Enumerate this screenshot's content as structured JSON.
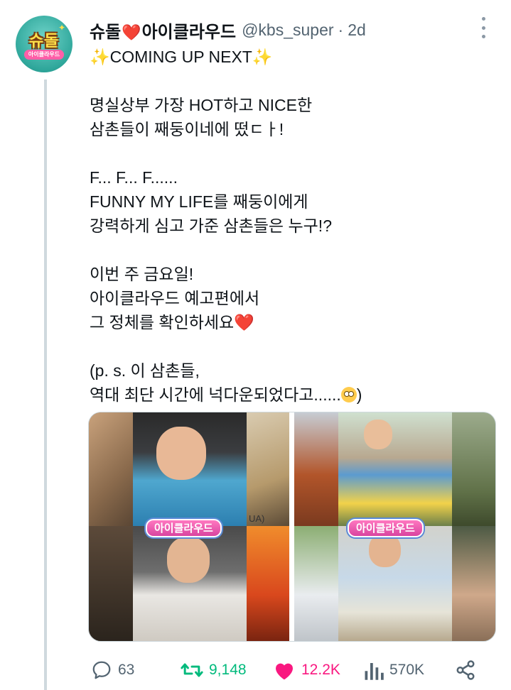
{
  "tweet": {
    "display_name_part1": "슈돌",
    "display_name_heart": "❤️",
    "display_name_part2": "아이클라우드",
    "handle": "@kbs_super",
    "separator": "·",
    "timestamp": "2d",
    "avatar_text": "슈돌",
    "avatar_subtext": "아이클라우드",
    "lines": [
      "COMING UP NEXT",
      "",
      "명실상부 가장 HOT하고 NICE한",
      "삼촌들이 째둥이네에 떴ㄷㅏ!",
      "",
      "F... F... F......",
      "FUNNY MY LIFE를 째둥이에게",
      "강력하게 심고 가준 삼촌들은 누구!?",
      "",
      "이번 주 금요일!",
      "아이클라우드 예고편에서",
      "그 정체를 확인하세요",
      "",
      "(p. s. 이 삼촌들,",
      "역대 최단 시간에 넉다운되었다고......",
      ")"
    ],
    "sparkle_left": "✨",
    "sparkle_right": "✨",
    "heart_emoji": "❤️"
  },
  "media": {
    "left_badge": "아이클라우드",
    "right_badge": "아이클라우드",
    "left_tag": "UA)"
  },
  "actions": {
    "replies": "63",
    "retweets": "9,148",
    "likes": "12.2K",
    "views": "570K"
  },
  "colors": {
    "like": "#f91880",
    "retweet": "#00ba7c",
    "muted": "#536471",
    "thread_line": "#cfd9de"
  },
  "icons": [
    "more-icon",
    "reply-icon",
    "retweet-icon",
    "like-icon",
    "views-icon",
    "share-icon"
  ]
}
